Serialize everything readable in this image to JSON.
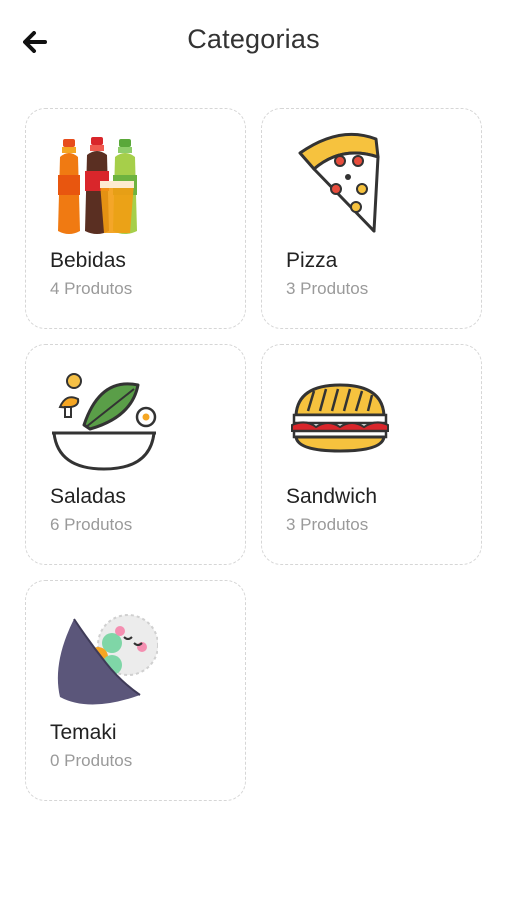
{
  "header": {
    "back_icon": "arrow-left-icon",
    "title": "Categorias"
  },
  "categories": [
    {
      "name": "Bebidas",
      "count": "4 Produtos",
      "icon": "drinks-icon"
    },
    {
      "name": "Pizza",
      "count": "3 Produtos",
      "icon": "pizza-slice-icon"
    },
    {
      "name": "Saladas",
      "count": "6 Produtos",
      "icon": "salad-bowl-icon"
    },
    {
      "name": "Sandwich",
      "count": "3 Produtos",
      "icon": "sandwich-icon"
    },
    {
      "name": "Temaki",
      "count": "0 Produtos",
      "icon": "temaki-icon"
    }
  ],
  "colors": {
    "background": "#ffffff",
    "card_border": "#d6d6d6",
    "text_primary": "#222222",
    "text_secondary": "#9a9a9a"
  }
}
